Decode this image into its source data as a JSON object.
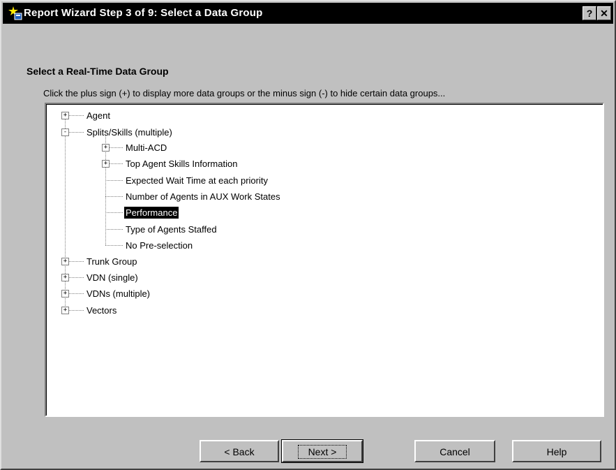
{
  "window": {
    "title": "Report Wizard Step 3 of 9: Select a Data Group",
    "help_button": "?",
    "close_button": "✕"
  },
  "heading": "Select a Real-Time Data Group",
  "instructions": "Click the plus sign (+) to display more data groups or the minus sign (-) to hide certain data groups...",
  "tree": {
    "items": [
      {
        "label": "Agent",
        "expander": "+"
      },
      {
        "label": "Splits/Skills (multiple)",
        "expander": "-"
      },
      {
        "label": "Multi-ACD",
        "expander": "+"
      },
      {
        "label": "Top Agent Skills Information",
        "expander": "+"
      },
      {
        "label": "Expected Wait Time at each priority"
      },
      {
        "label": "Number of Agents in AUX Work States"
      },
      {
        "label": "Performance",
        "selected": true
      },
      {
        "label": "Type of Agents Staffed"
      },
      {
        "label": "No Pre-selection"
      },
      {
        "label": "Trunk Group",
        "expander": "+"
      },
      {
        "label": "VDN (single)",
        "expander": "+"
      },
      {
        "label": "VDNs (multiple)",
        "expander": "+"
      },
      {
        "label": "Vectors",
        "expander": "+"
      }
    ]
  },
  "buttons": {
    "back": "< Back",
    "next": "Next >",
    "cancel": "Cancel",
    "help": "Help"
  }
}
